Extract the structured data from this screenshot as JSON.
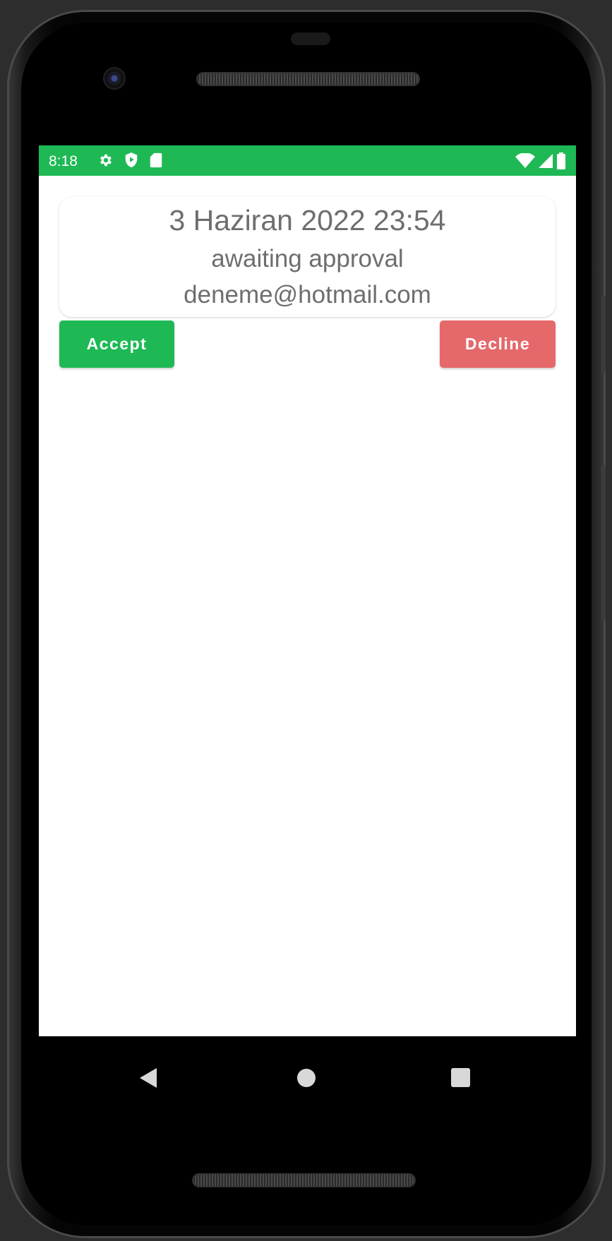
{
  "status_bar": {
    "time": "8:18",
    "background_color": "#1eb955",
    "left_icons": [
      "settings-gear-icon",
      "play-protect-icon",
      "sd-card-icon"
    ],
    "right_icons": [
      "wifi-icon",
      "cell-signal-icon",
      "battery-icon"
    ]
  },
  "request_card": {
    "date": "3 Haziran 2022 23:54",
    "status": "awaiting approval",
    "email": "deneme@hotmail.com"
  },
  "actions": {
    "accept_label": "Accept",
    "accept_color": "#1eb955",
    "decline_label": "Decline",
    "decline_color": "#e5686a"
  },
  "nav_bar": {
    "icons": [
      "back-icon",
      "home-icon",
      "recents-icon"
    ]
  }
}
